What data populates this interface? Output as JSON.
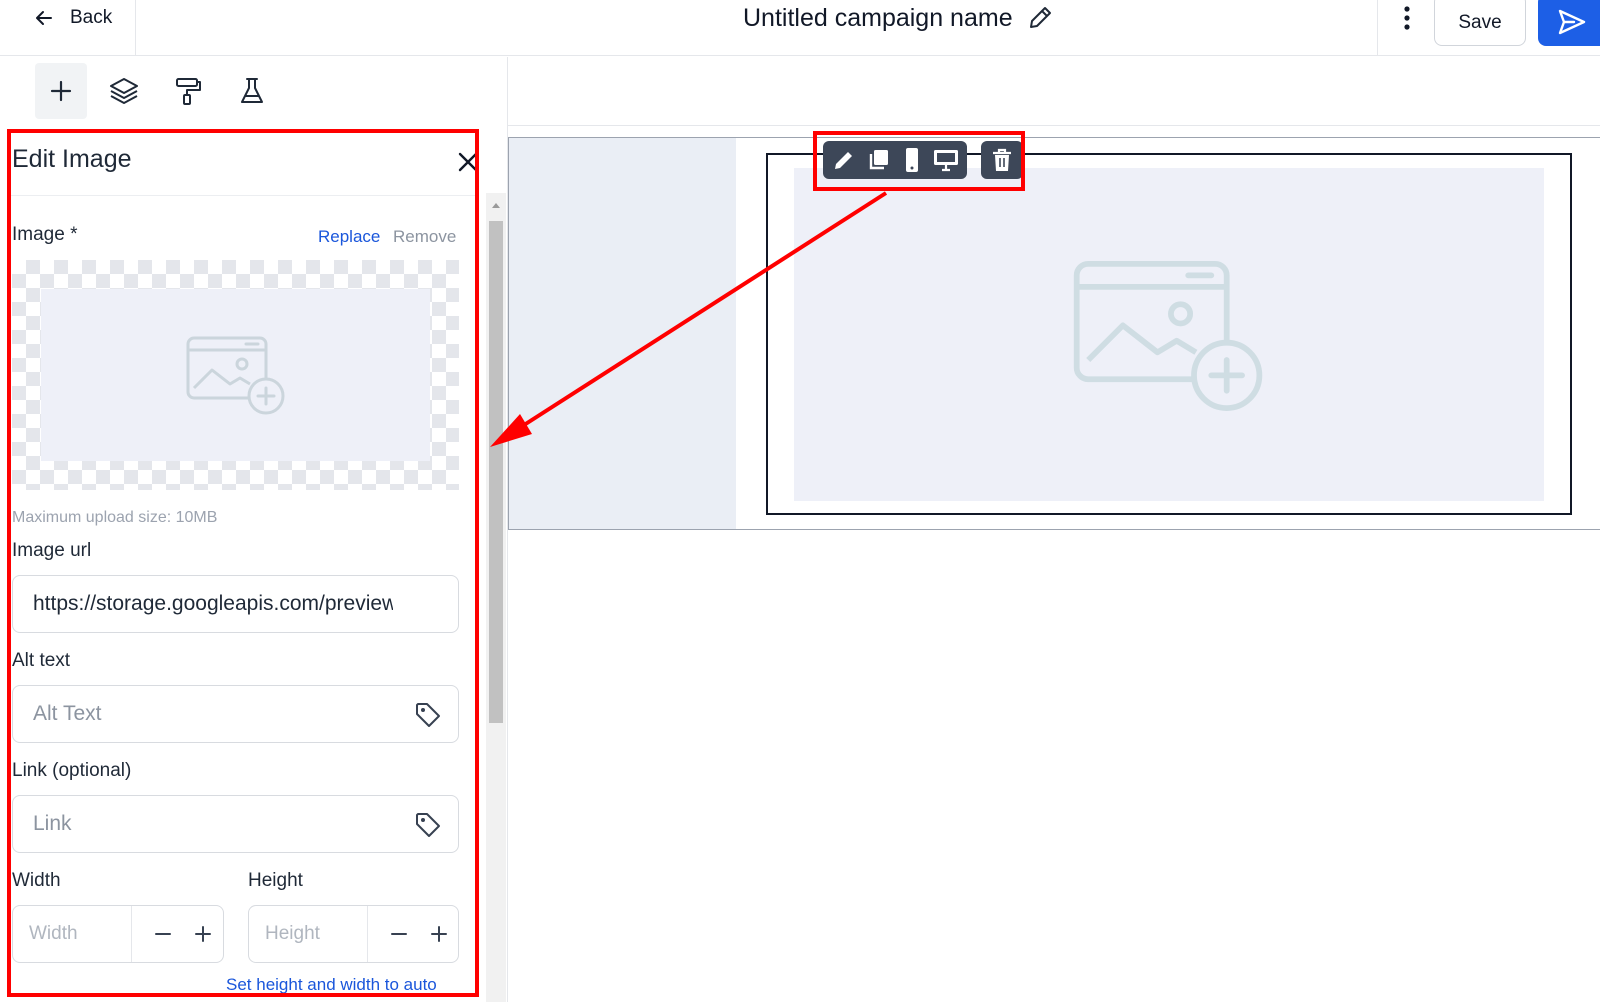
{
  "header": {
    "back_label": "Back",
    "campaign_title": "Untitled campaign name",
    "save_label": "Save"
  },
  "tools": [
    "plus-icon",
    "layers-icon",
    "paint-roller-icon",
    "flask-icon"
  ],
  "panel": {
    "title": "Edit Image",
    "image_label": "Image *",
    "replace_label": "Replace",
    "remove_label": "Remove",
    "upload_hint": "Maximum upload size: 10MB",
    "image_url_label": "Image url",
    "image_url_value": "https://storage.googleapis.com/preview",
    "alt_text_label": "Alt text",
    "alt_text_placeholder": "Alt Text",
    "link_label": "Link (optional)",
    "link_placeholder": "Link",
    "width_label": "Width",
    "width_placeholder": "Width",
    "height_label": "Height",
    "height_placeholder": "Height",
    "auto_size_label": "Set height and width to auto"
  },
  "block_toolbar": [
    "pencil-icon",
    "duplicate-icon",
    "mobile-icon",
    "desktop-icon",
    "trash-icon"
  ],
  "colors": {
    "primary": "#1d5fe6",
    "link": "#1a56db",
    "annotation": "#ff0000",
    "toolbar_bg": "#3d4758"
  }
}
